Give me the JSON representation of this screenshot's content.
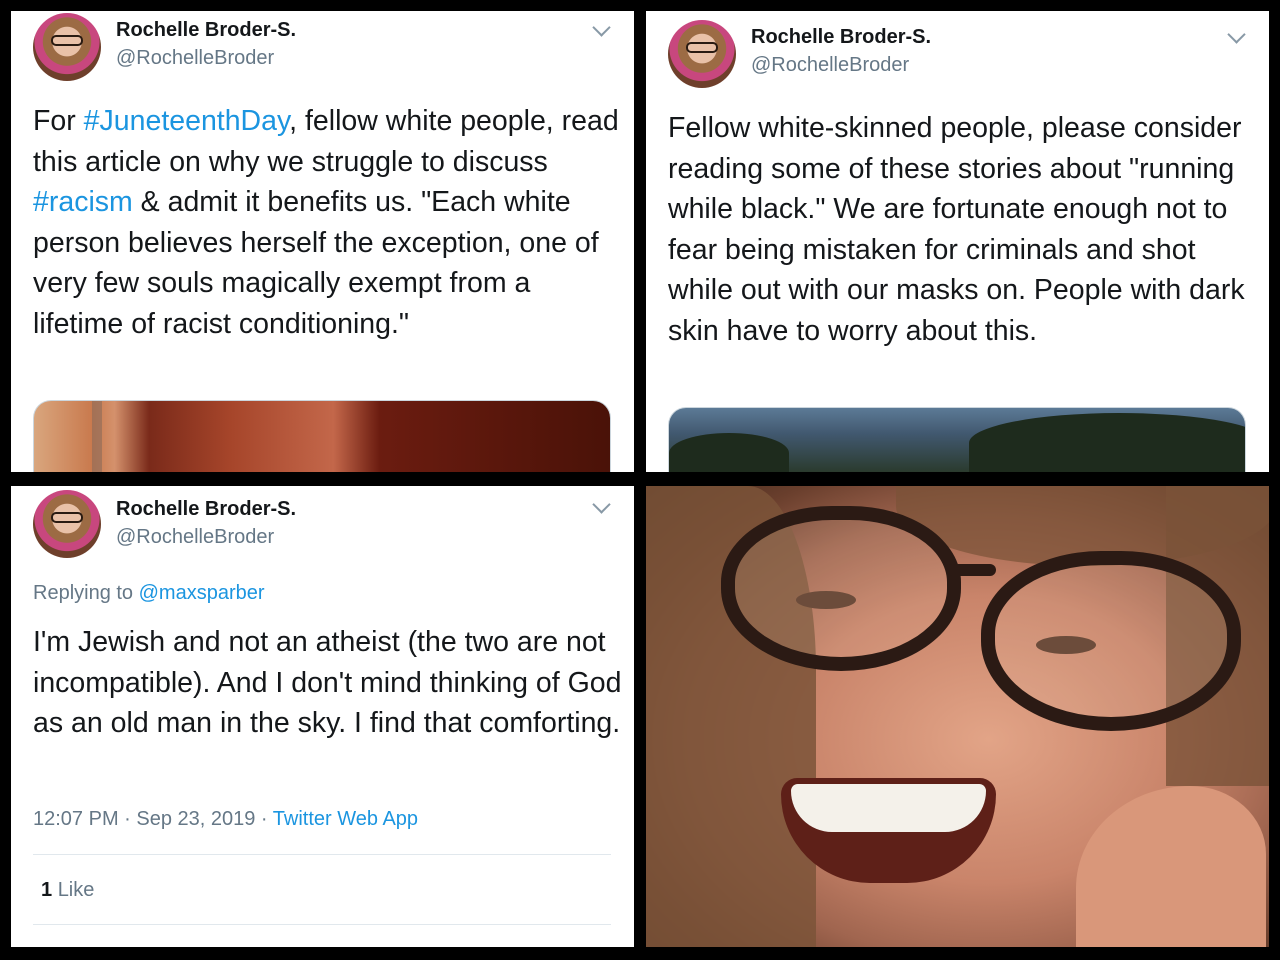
{
  "tweets": [
    {
      "display_name": "Rochelle Broder-S.",
      "handle": "@RochelleBroder",
      "text_parts": [
        {
          "text": "For ",
          "link": false
        },
        {
          "text": "#JuneteenthDay",
          "link": true
        },
        {
          "text": ", fellow white people, read this article on why we struggle to discuss ",
          "link": false
        },
        {
          "text": "#racism",
          "link": true
        },
        {
          "text": " & admit it benefits us. \"Each white person believes herself the exception, one of very few souls magically exempt from a lifetime of racist conditioning.\"",
          "link": false
        }
      ]
    },
    {
      "display_name": "Rochelle Broder-S.",
      "handle": "@RochelleBroder",
      "text": "Fellow white-skinned people, please consider reading some of these stories about \"running while black.\" We are fortunate enough not to fear being mistaken for criminals and shot while out with our masks on. People with dark skin have to worry about this."
    },
    {
      "display_name": "Rochelle Broder-S.",
      "handle": "@RochelleBroder",
      "replying_prefix": "Replying to",
      "replying_to": "@maxsparber",
      "text": "I'm Jewish and not an atheist (the two are not incompatible). And I don't mind thinking of God as an old man in the sky. I find that comforting.",
      "timestamp": "12:07 PM · Sep 23, 2019 ·",
      "source": "Twitter Web App",
      "like_count": "1",
      "like_label": "Like"
    }
  ],
  "icons": {
    "menu": "chevron-down-icon"
  },
  "colors": {
    "link": "#1b95e0",
    "secondary_text": "#657786",
    "primary_text": "#14171a",
    "divider": "#e1e8ed",
    "background": "#000000"
  }
}
